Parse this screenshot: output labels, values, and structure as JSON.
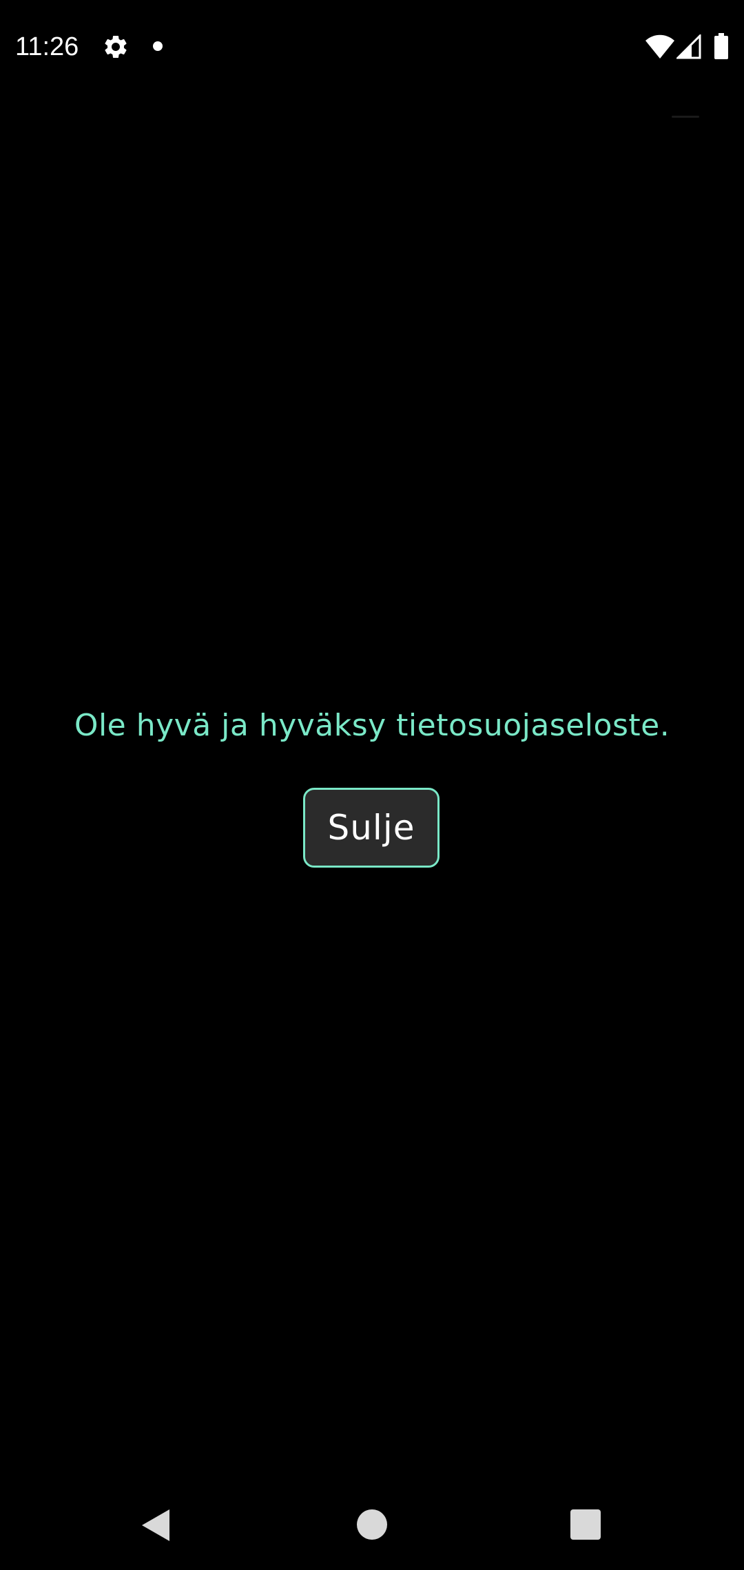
{
  "status_bar": {
    "time": "11:26",
    "icons": [
      "gear-icon",
      "notification-dot-icon",
      "wifi-icon",
      "signal-icon",
      "battery-icon"
    ]
  },
  "dialog": {
    "message": "Ole hyvä ja hyväksy tietosuojaseloste.",
    "close_label": "Sulje"
  },
  "nav_bar": {
    "icons": [
      "back-icon",
      "home-icon",
      "recents-icon"
    ]
  },
  "colors": {
    "background": "#000000",
    "accent": "#7ae8c7",
    "button_bg": "#2b2b2b",
    "text": "#ffffff"
  }
}
